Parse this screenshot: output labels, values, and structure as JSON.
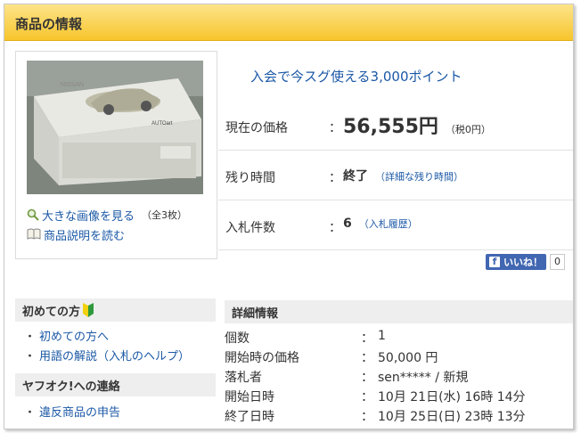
{
  "header": {
    "title": "商品の情報"
  },
  "photo_links": [
    {
      "label": "大きな画像を見る",
      "note": "（全3枚）",
      "icon": "magnifier-icon"
    },
    {
      "label": "商品説明を読む",
      "note": "",
      "icon": "book-icon"
    }
  ],
  "photo_box_text": {
    "brand": "NISSAN",
    "logo": "AUTOart"
  },
  "promo": "入会で今スグ使える3,000ポイント",
  "price_rows": [
    {
      "label": "現在の価格",
      "colon": "：",
      "value": "56,555円",
      "sub": "（税0円）"
    },
    {
      "label": "残り時間",
      "colon": "：",
      "value": "終了",
      "sub": "（詳細な残り時間）"
    },
    {
      "label": "入札件数",
      "colon": "：",
      "value": "6",
      "sub": "（入札履歴）"
    }
  ],
  "like": {
    "label": "いいね！",
    "count": "0"
  },
  "sidebar": {
    "beginner_title": "初めての方",
    "beginner_links": [
      "初めての方へ",
      "用語の解説（入札のヘルプ）"
    ],
    "contact_title": "ヤフオク!への連絡",
    "contact_links": [
      "違反商品の申告"
    ],
    "bullet": "・"
  },
  "detail": {
    "title": "詳細情報",
    "rows": [
      {
        "label": "個数",
        "colon": "：",
        "value": "1"
      },
      {
        "label": "開始時の価格",
        "colon": "：",
        "value": "50,000 円"
      },
      {
        "label": "落札者",
        "colon": "：",
        "value": "sen***** / 新規"
      },
      {
        "label": "開始日時",
        "colon": "：",
        "value": "10月 21日(水) 16時 14分"
      },
      {
        "label": "終了日時",
        "colon": "：",
        "value": "10月 25日(日) 23時 13分"
      }
    ]
  },
  "colors": {
    "header_top": "#fde48a",
    "header_bottom": "#f7c52c",
    "link": "#1b58a6",
    "facebook": "#4267b2"
  }
}
